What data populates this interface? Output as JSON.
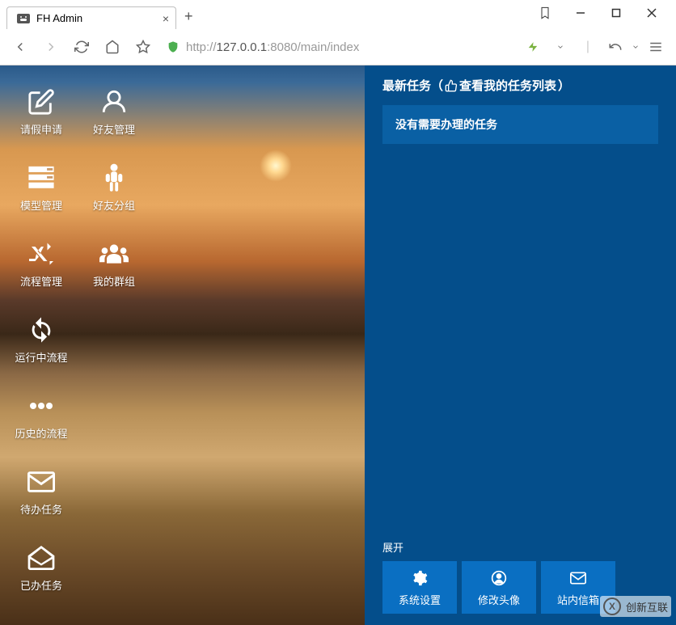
{
  "browser": {
    "tab_title": "FH Admin",
    "url_prefix": "http://",
    "url_host": "127.0.0.1",
    "url_port": ":8080",
    "url_path": "/main/index"
  },
  "sidebar": {
    "items": [
      {
        "label": "请假申请",
        "icon": "edit"
      },
      {
        "label": "好友管理",
        "icon": "user"
      },
      {
        "label": "模型管理",
        "icon": "server"
      },
      {
        "label": "好友分组",
        "icon": "person"
      },
      {
        "label": "流程管理",
        "icon": "shuffle"
      },
      {
        "label": "我的群组",
        "icon": "group"
      },
      {
        "label": "运行中流程",
        "icon": "refresh"
      },
      {
        "label": "历史的流程",
        "icon": "dots"
      },
      {
        "label": "待办任务",
        "icon": "envelope"
      },
      {
        "label": "已办任务",
        "icon": "envelope-open"
      }
    ]
  },
  "right": {
    "header_prefix": "最新任务（",
    "header_link": " 查看我的任务列表",
    "header_suffix": "）",
    "no_task": "没有需要办理的任务",
    "expand": "展开",
    "buttons": [
      {
        "label": "系统设置",
        "icon": "gear"
      },
      {
        "label": "修改头像",
        "icon": "user-circle"
      },
      {
        "label": "站内信箱",
        "icon": "mailbox"
      }
    ]
  },
  "watermark": "创新互联"
}
